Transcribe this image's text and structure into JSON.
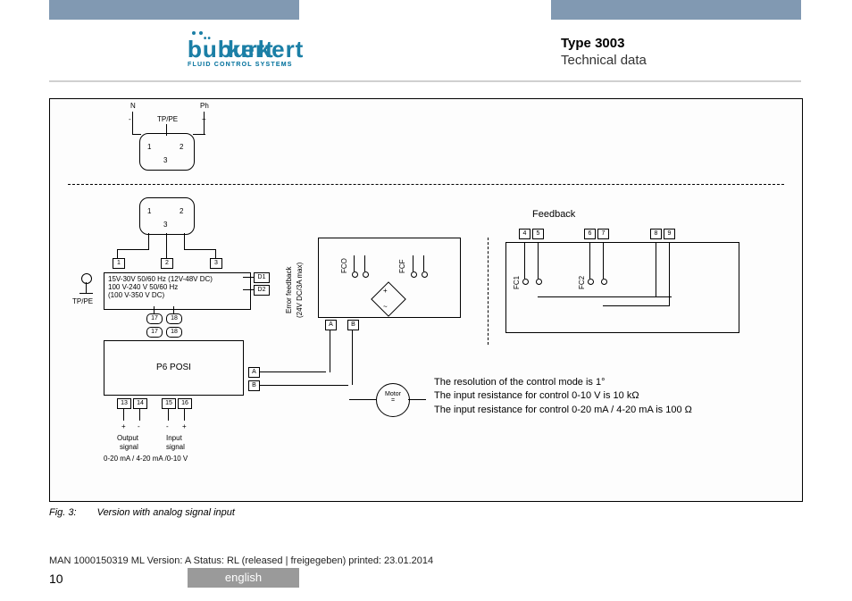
{
  "branding": {
    "logo_name": "burkert",
    "logo_tagline": "FLUID CONTROL SYSTEMS"
  },
  "title": {
    "line1": "Type 3003",
    "line2": "Technical data"
  },
  "diagram": {
    "labels": {
      "N": "N",
      "Ph": "Ph",
      "TPPE_top": "TP/PE",
      "TPPE_left": "TP/PE",
      "plus": "+",
      "minus": "-",
      "conn_1": "1",
      "conn_2": "2",
      "conn_3": "3",
      "box1": "1",
      "box2": "2",
      "box3": "3",
      "range1": "15V-30V 50/60 Hz (12V-48V DC)",
      "range2": "100 V-240 V 50/60 Hz",
      "range3": "(100 V-350 V DC)",
      "D1": "D1",
      "D2": "D2",
      "errfb": "Error feedback",
      "errfb2": "(24V DC/3A max)",
      "t17": "17",
      "t18": "18",
      "p6": "P6 POSI",
      "t13": "13",
      "t14": "14",
      "t15": "15",
      "t16": "16",
      "out": "Output",
      "sig": "signal",
      "in": "Input",
      "range_bottom": "0-20 mA / 4-20 mA /0-10 V",
      "A": "A",
      "B": "B",
      "motor": "Motor",
      "motor_sym": "=",
      "FCO": "FCO",
      "FCF": "FCF",
      "FC1": "FC1",
      "FC2": "FC2",
      "feedback": "Feedback",
      "fb4": "4",
      "fb5": "5",
      "fb6": "6",
      "fb7": "7",
      "fb8": "8",
      "fb9": "9"
    }
  },
  "notes": {
    "l1": "The resolution of the control mode is 1°",
    "l2": "The input resistance for control 0-10 V is 10 kΩ",
    "l3": "The input resistance for control 0-20 mA / 4-20 mA is  100 Ω"
  },
  "caption": {
    "figno": "Fig. 3:",
    "text": "Version with analog signal input"
  },
  "footer": {
    "line": "MAN 1000150319 ML Version: A Status: RL (released | freigegeben) printed: 23.01.2014",
    "pagenum": "10",
    "lang": "english"
  }
}
